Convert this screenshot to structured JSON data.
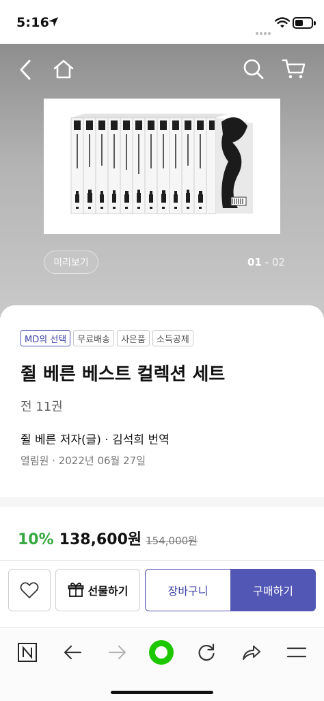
{
  "status_bar": {
    "time": "5:16"
  },
  "hero": {
    "preview_label": "미리보기",
    "page_current": "01",
    "page_sep": " - ",
    "page_total": "02"
  },
  "product": {
    "badges": [
      "MD의 선택",
      "무료배송",
      "사은품",
      "소득공제"
    ],
    "title": "쥘 베른 베스트 컬렉션 세트",
    "volumes": "전 11권",
    "authors": "쥘 베른 저자(글) · 김석희 번역",
    "publisher_date": "열림원 · 2022년 06월 27일"
  },
  "price": {
    "discount": "10%",
    "sale_price": "138,600원",
    "original_price": "154,000원"
  },
  "actions": {
    "gift_label": "선물하기",
    "cart_label": "장바구니",
    "buy_label": "구매하기"
  },
  "colors": {
    "accent": "#5257b5",
    "discount_green": "#36a840",
    "browser_green": "#1ec800"
  },
  "icons": {
    "header": [
      "back-icon",
      "home-icon",
      "search-icon",
      "cart-icon"
    ],
    "action": [
      "heart-icon",
      "gift-icon"
    ],
    "browser": [
      "naver-n-icon",
      "back-arrow-icon",
      "forward-arrow-icon",
      "green-dot-icon",
      "reload-icon",
      "share-icon",
      "menu-icon"
    ]
  }
}
